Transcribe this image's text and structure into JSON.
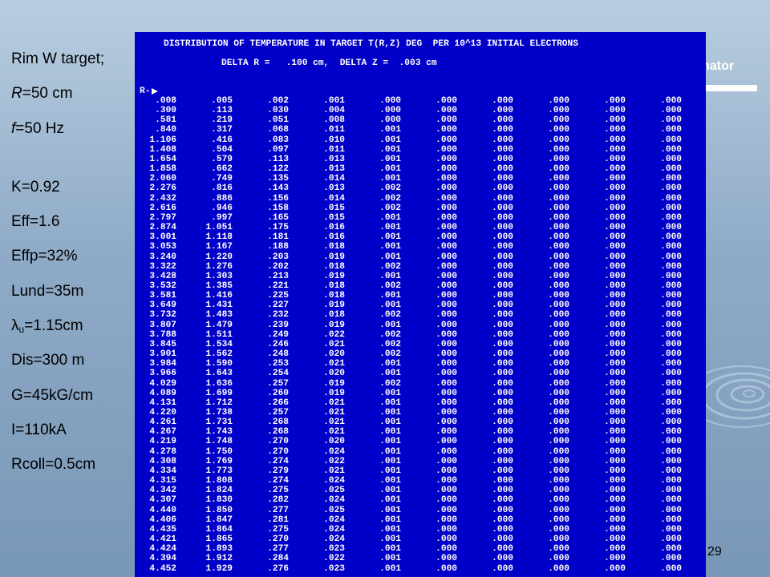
{
  "slide": {
    "page_number": "29",
    "collimator_label": "Collimator"
  },
  "params": [
    {
      "prefix": "Rim W target;",
      "italic": "",
      "sub": "",
      "suffix": ""
    },
    {
      "prefix": "",
      "italic": "R",
      "sub": "",
      "suffix": "=50 cm"
    },
    {
      "prefix": "",
      "italic": "f",
      "sub": "",
      "suffix": "=50 Hz"
    },
    {
      "prefix": "K=0.92",
      "italic": "",
      "sub": "",
      "suffix": ""
    },
    {
      "prefix": "Eff=1.6",
      "italic": "",
      "sub": "",
      "suffix": ""
    },
    {
      "prefix": "Effp=32%",
      "italic": "",
      "sub": "",
      "suffix": ""
    },
    {
      "prefix": "Lund=35m",
      "italic": "",
      "sub": "",
      "suffix": ""
    },
    {
      "prefix": "λ",
      "italic": "",
      "sub": "u",
      "suffix": "=1.15cm"
    },
    {
      "prefix": "Dis=300 m",
      "italic": "",
      "sub": "",
      "suffix": ""
    },
    {
      "prefix": "G=45kG/cm",
      "italic": "",
      "sub": "",
      "suffix": ""
    },
    {
      "prefix": "I=110kA",
      "italic": "",
      "sub": "",
      "suffix": ""
    },
    {
      "prefix": "Rcoll=0.5cm",
      "italic": "",
      "sub": "",
      "suffix": ""
    }
  ],
  "terminal": {
    "title": "DISTRIBUTION OF TEMPERATURE IN TARGET T(R,Z) DEG  PER 10^13 INITIAL ELECTRONS",
    "subtitle": "DELTA R =   .100 cm,  DELTA Z =  .003 cm",
    "r_label": "R-",
    "rows": [
      [
        ".008",
        ".005",
        ".002",
        ".001",
        ".000",
        ".000",
        ".000",
        ".000",
        ".000",
        ".000"
      ],
      [
        ".300",
        ".113",
        ".030",
        ".004",
        ".000",
        ".000",
        ".000",
        ".000",
        ".000",
        ".000"
      ],
      [
        ".581",
        ".219",
        ".051",
        ".008",
        ".000",
        ".000",
        ".000",
        ".000",
        ".000",
        ".000"
      ],
      [
        ".840",
        ".317",
        ".068",
        ".011",
        ".001",
        ".000",
        ".000",
        ".000",
        ".000",
        ".000"
      ],
      [
        "1.106",
        ".416",
        ".083",
        ".010",
        ".001",
        ".000",
        ".000",
        ".000",
        ".000",
        ".000"
      ],
      [
        "1.408",
        ".504",
        ".097",
        ".011",
        ".001",
        ".000",
        ".000",
        ".000",
        ".000",
        ".000"
      ],
      [
        "1.654",
        ".579",
        ".113",
        ".013",
        ".001",
        ".000",
        ".000",
        ".000",
        ".000",
        ".000"
      ],
      [
        "1.858",
        ".662",
        ".122",
        ".013",
        ".001",
        ".000",
        ".000",
        ".000",
        ".000",
        ".000"
      ],
      [
        "2.060",
        ".749",
        ".135",
        ".014",
        ".001",
        ".000",
        ".000",
        ".000",
        ".000",
        ".000"
      ],
      [
        "2.276",
        ".816",
        ".143",
        ".013",
        ".002",
        ".000",
        ".000",
        ".000",
        ".000",
        ".000"
      ],
      [
        "2.432",
        ".886",
        ".156",
        ".014",
        ".002",
        ".000",
        ".000",
        ".000",
        ".000",
        ".000"
      ],
      [
        "2.616",
        ".946",
        ".158",
        ".015",
        ".002",
        ".000",
        ".000",
        ".000",
        ".000",
        ".000"
      ],
      [
        "2.797",
        ".997",
        ".165",
        ".015",
        ".001",
        ".000",
        ".000",
        ".000",
        ".000",
        ".000"
      ],
      [
        "2.874",
        "1.051",
        ".175",
        ".016",
        ".001",
        ".000",
        ".000",
        ".000",
        ".000",
        ".000"
      ],
      [
        "3.001",
        "1.118",
        ".181",
        ".016",
        ".001",
        ".000",
        ".000",
        ".000",
        ".000",
        ".000"
      ],
      [
        "3.053",
        "1.167",
        ".188",
        ".018",
        ".001",
        ".000",
        ".000",
        ".000",
        ".000",
        ".000"
      ],
      [
        "3.240",
        "1.220",
        ".203",
        ".019",
        ".001",
        ".000",
        ".000",
        ".000",
        ".000",
        ".000"
      ],
      [
        "3.322",
        "1.276",
        ".202",
        ".018",
        ".002",
        ".000",
        ".000",
        ".000",
        ".000",
        ".000"
      ],
      [
        "3.428",
        "1.303",
        ".213",
        ".019",
        ".001",
        ".000",
        ".000",
        ".000",
        ".000",
        ".000"
      ],
      [
        "3.532",
        "1.385",
        ".221",
        ".018",
        ".002",
        ".000",
        ".000",
        ".000",
        ".000",
        ".000"
      ],
      [
        "3.581",
        "1.416",
        ".225",
        ".018",
        ".001",
        ".000",
        ".000",
        ".000",
        ".000",
        ".000"
      ],
      [
        "3.649",
        "1.431",
        ".227",
        ".019",
        ".001",
        ".000",
        ".000",
        ".000",
        ".000",
        ".000"
      ],
      [
        "3.732",
        "1.483",
        ".232",
        ".018",
        ".002",
        ".000",
        ".000",
        ".000",
        ".000",
        ".000"
      ],
      [
        "3.807",
        "1.479",
        ".239",
        ".019",
        ".001",
        ".000",
        ".000",
        ".000",
        ".000",
        ".000"
      ],
      [
        "3.788",
        "1.511",
        ".249",
        ".022",
        ".002",
        ".000",
        ".000",
        ".000",
        ".000",
        ".000"
      ],
      [
        "3.845",
        "1.534",
        ".246",
        ".021",
        ".002",
        ".000",
        ".000",
        ".000",
        ".000",
        ".000"
      ],
      [
        "3.901",
        "1.562",
        ".248",
        ".020",
        ".002",
        ".000",
        ".000",
        ".000",
        ".000",
        ".000"
      ],
      [
        "3.984",
        "1.590",
        ".253",
        ".021",
        ".001",
        ".000",
        ".000",
        ".000",
        ".000",
        ".000"
      ],
      [
        "3.966",
        "1.643",
        ".254",
        ".020",
        ".001",
        ".000",
        ".000",
        ".000",
        ".000",
        ".000"
      ],
      [
        "4.029",
        "1.636",
        ".257",
        ".019",
        ".002",
        ".000",
        ".000",
        ".000",
        ".000",
        ".000"
      ],
      [
        "4.089",
        "1.699",
        ".260",
        ".019",
        ".001",
        ".000",
        ".000",
        ".000",
        ".000",
        ".000"
      ],
      [
        "4.131",
        "1.712",
        ".266",
        ".021",
        ".001",
        ".000",
        ".000",
        ".000",
        ".000",
        ".000"
      ],
      [
        "4.220",
        "1.738",
        ".257",
        ".021",
        ".001",
        ".000",
        ".000",
        ".000",
        ".000",
        ".000"
      ],
      [
        "4.261",
        "1.731",
        ".268",
        ".021",
        ".001",
        ".000",
        ".000",
        ".000",
        ".000",
        ".000"
      ],
      [
        "4.267",
        "1.743",
        ".268",
        ".021",
        ".001",
        ".000",
        ".000",
        ".000",
        ".000",
        ".000"
      ],
      [
        "4.219",
        "1.748",
        ".270",
        ".020",
        ".001",
        ".000",
        ".000",
        ".000",
        ".000",
        ".000"
      ],
      [
        "4.278",
        "1.750",
        ".270",
        ".024",
        ".001",
        ".000",
        ".000",
        ".000",
        ".000",
        ".000"
      ],
      [
        "4.308",
        "1.769",
        ".274",
        ".022",
        ".001",
        ".000",
        ".000",
        ".000",
        ".000",
        ".000"
      ],
      [
        "4.334",
        "1.773",
        ".279",
        ".021",
        ".001",
        ".000",
        ".000",
        ".000",
        ".000",
        ".000"
      ],
      [
        "4.315",
        "1.808",
        ".274",
        ".024",
        ".001",
        ".000",
        ".000",
        ".000",
        ".000",
        ".000"
      ],
      [
        "4.342",
        "1.824",
        ".275",
        ".025",
        ".001",
        ".000",
        ".000",
        ".000",
        ".000",
        ".000"
      ],
      [
        "4.307",
        "1.830",
        ".282",
        ".024",
        ".001",
        ".000",
        ".000",
        ".000",
        ".000",
        ".000"
      ],
      [
        "4.440",
        "1.850",
        ".277",
        ".025",
        ".001",
        ".000",
        ".000",
        ".000",
        ".000",
        ".000"
      ],
      [
        "4.406",
        "1.847",
        ".281",
        ".024",
        ".001",
        ".000",
        ".000",
        ".000",
        ".000",
        ".000"
      ],
      [
        "4.435",
        "1.864",
        ".275",
        ".024",
        ".001",
        ".000",
        ".000",
        ".000",
        ".000",
        ".000"
      ],
      [
        "4.421",
        "1.865",
        ".270",
        ".024",
        ".001",
        ".000",
        ".000",
        ".000",
        ".000",
        ".000"
      ],
      [
        "4.424",
        "1.893",
        ".277",
        ".023",
        ".001",
        ".000",
        ".000",
        ".000",
        ".000",
        ".000"
      ],
      [
        "4.394",
        "1.912",
        ".284",
        ".022",
        ".001",
        ".000",
        ".000",
        ".000",
        ".000",
        ".000"
      ],
      [
        "4.452",
        "1.929",
        ".276",
        ".023",
        ".001",
        ".000",
        ".000",
        ".000",
        ".000",
        ".000"
      ]
    ]
  },
  "icons": {
    "r_arrow": "arrow-right-icon",
    "decoration": "swirl-icon"
  },
  "colors": {
    "terminal_bg": "#0000c8",
    "terminal_text": "#ffffff",
    "slide_bg": "#8da9c4"
  }
}
